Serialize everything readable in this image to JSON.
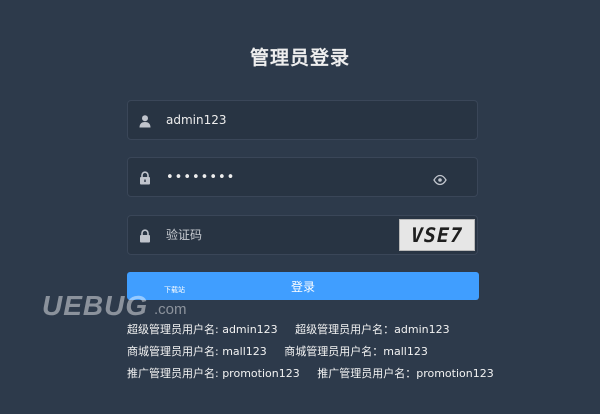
{
  "page": {
    "title": "管理员登录"
  },
  "form": {
    "username_value": "admin123",
    "password_value": "••••••••",
    "captcha_placeholder": "验证码",
    "captcha_image_text": "VSE7",
    "login_button": "登录"
  },
  "accounts": {
    "rows": [
      [
        "超级管理员用户名: admin123",
        "超级管理员用户名：admin123"
      ],
      [
        "商城管理员用户名: mall123",
        "商城管理员用户名：mall123"
      ],
      [
        "推广管理员用户名: promotion123",
        "推广管理员用户名：promotion123"
      ]
    ]
  },
  "watermark": {
    "brand": "UEBUG",
    "domain": ".com",
    "badge": "下载站"
  },
  "colors": {
    "background": "#2d3a4b",
    "input_bg": "#283443",
    "primary": "#409eff"
  },
  "icons": {
    "user": "user-icon",
    "lock": "lock-icon",
    "eye": "eye-icon"
  }
}
